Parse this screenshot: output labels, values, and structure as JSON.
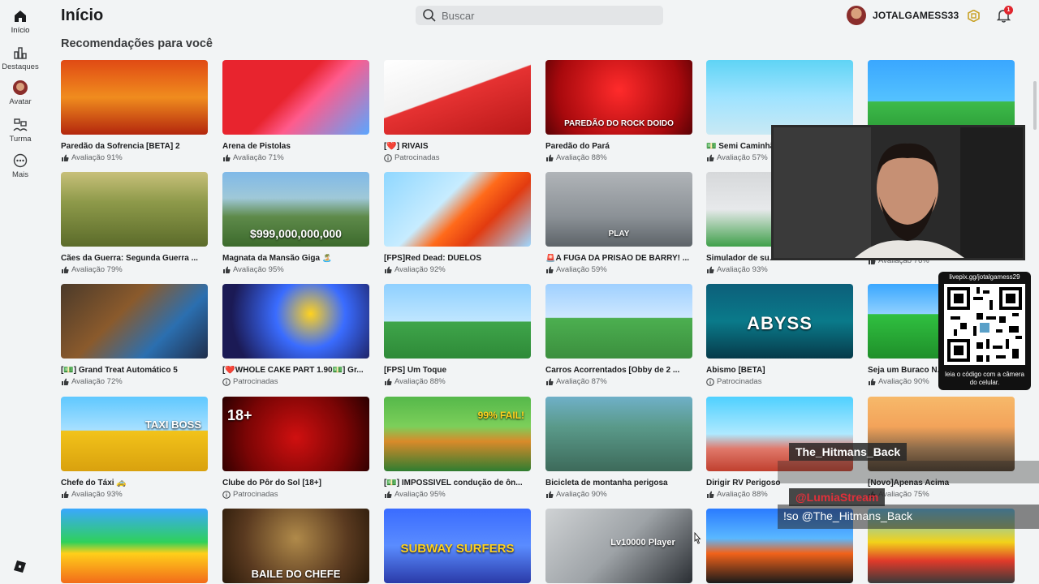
{
  "sidebar": {
    "items": [
      {
        "label": "Início",
        "icon": "home-icon"
      },
      {
        "label": "Destaques",
        "icon": "charts-icon"
      },
      {
        "label": "Avatar",
        "icon": "avatar-icon"
      },
      {
        "label": "Turma",
        "icon": "people-icon"
      },
      {
        "label": "Mais",
        "icon": "more-icon"
      }
    ]
  },
  "header": {
    "title": "Início",
    "search_placeholder": "Buscar",
    "username": "JOTALGAMESS33",
    "notifications": "1"
  },
  "section_title": "Recomendações para você",
  "games": [
    {
      "title": "Paredão da Sofrencia [BETA] 2",
      "meta": "Avaliação 91%",
      "meta_type": "rating"
    },
    {
      "title": "Arena de Pistolas",
      "meta": "Avaliação 71%",
      "meta_type": "rating"
    },
    {
      "title": "[❤️] RIVAIS",
      "meta": "Patrocinadas",
      "meta_type": "sponsored"
    },
    {
      "title": "Paredão do Pará",
      "meta": "Avaliação 88%",
      "meta_type": "rating",
      "overtext": "PAREDÃO DO ROCK DOIDO"
    },
    {
      "title": "💵 Semi Caminhão",
      "meta": "Avaliação 57%",
      "meta_type": "rating"
    },
    {
      "title": "",
      "meta": "",
      "meta_type": "none"
    },
    {
      "title": "Cães da Guerra: Segunda Guerra ...",
      "meta": "Avaliação 79%",
      "meta_type": "rating"
    },
    {
      "title": "Magnata da Mansão Giga 🏝️",
      "meta": "Avaliação 95%",
      "meta_type": "rating",
      "overtext": "$999,000,000,000"
    },
    {
      "title": "[FPS]Red Dead: DUELOS",
      "meta": "Avaliação 92%",
      "meta_type": "rating"
    },
    {
      "title": "🚨A FUGA DA PRISÃO DE BARRY! ...",
      "meta": "Avaliação 59%",
      "meta_type": "rating",
      "overtext": "PLAY"
    },
    {
      "title": "Simulador de su...",
      "meta": "Avaliação 93%",
      "meta_type": "rating"
    },
    {
      "title": "",
      "meta": "Avaliação 76%",
      "meta_type": "rating"
    },
    {
      "title": "[💵] Grand Treat Automático 5",
      "meta": "Avaliação 72%",
      "meta_type": "rating"
    },
    {
      "title": "[❤️WHOLE CAKE PART 1.90💵] Gr...",
      "meta": "Patrocinadas",
      "meta_type": "sponsored"
    },
    {
      "title": "[FPS] Um Toque",
      "meta": "Avaliação 88%",
      "meta_type": "rating"
    },
    {
      "title": "Carros Acorrentados [Obby de 2 ...",
      "meta": "Avaliação 87%",
      "meta_type": "rating"
    },
    {
      "title": "Abismo [BETA]",
      "meta": "Patrocinadas",
      "meta_type": "sponsored",
      "overtext": "ABYSS"
    },
    {
      "title": "Seja um Buraco N...",
      "meta": "Avaliação 90%",
      "meta_type": "rating"
    },
    {
      "title": "Chefe do Táxi 🚕",
      "meta": "Avaliação 93%",
      "meta_type": "rating",
      "overtext": "TAXI BOSS"
    },
    {
      "title": "Clube do Pôr do Sol [18+]",
      "meta": "Patrocinadas",
      "meta_type": "sponsored",
      "overtext": "18+"
    },
    {
      "title": "[💵] IMPOSSÍVEL condução de ôn...",
      "meta": "Avaliação 95%",
      "meta_type": "rating",
      "overtext": "99% FAIL!"
    },
    {
      "title": "Bicicleta de montanha perigosa",
      "meta": "Avaliação 90%",
      "meta_type": "rating"
    },
    {
      "title": "Dirigir RV Perigoso",
      "meta": "Avaliação 88%",
      "meta_type": "rating"
    },
    {
      "title": "[Novo]Apenas Acima",
      "meta": "Avaliação 75%",
      "meta_type": "rating"
    },
    {
      "title": "",
      "meta": "",
      "meta_type": "none"
    },
    {
      "title": "",
      "meta": "",
      "meta_type": "none",
      "overtext": "BAILE DO CHEFE"
    },
    {
      "title": "",
      "meta": "",
      "meta_type": "none",
      "overtext": "SUBWAY SURFERS"
    },
    {
      "title": "",
      "meta": "",
      "meta_type": "none",
      "overtext": "Lv10000 Player"
    },
    {
      "title": "",
      "meta": "",
      "meta_type": "none"
    },
    {
      "title": "",
      "meta": "",
      "meta_type": "none"
    }
  ],
  "stream_overlay": {
    "qr_url": "livepix.gg/jotalgamess29",
    "qr_caption": "leia o código com a câmera do celular.",
    "chat_user": "The_Hitmans_Back",
    "chat_bot": "@LumiaStream",
    "chat_message": "!so @The_Hitmans_Back"
  },
  "colors": {
    "background": "#f2f4f5",
    "text": "#1b1c1e",
    "muted": "#5f6265",
    "badge": "#e0252d"
  }
}
